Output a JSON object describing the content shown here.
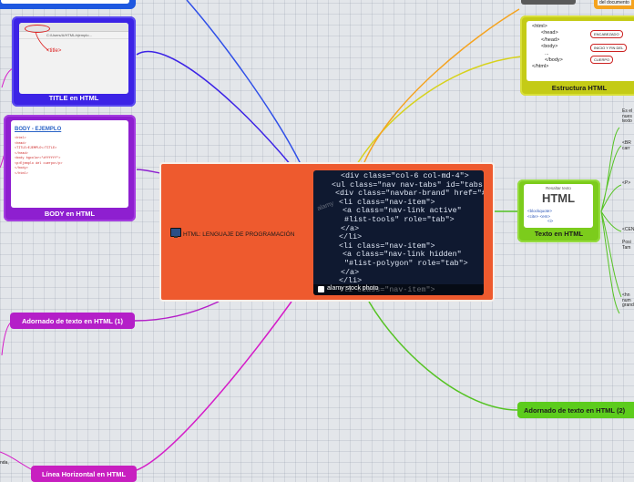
{
  "central": {
    "icon": "computer-icon",
    "title": "HTML: LENGUAJE DE PROGRAMACIÓN",
    "image_code": [
      "<div class=\"col-6 col-md-4\">",
      "<ul class=\"nav nav-tabs\" id=\"tabs\">",
      "<div class=\"navbar-brand\" href=\"#\">",
      "<li class=\"nav-item\">",
      "<a class=\"nav-link active\"",
      "#list-tools\" role=\"tab\">",
      "</a>",
      "</li>",
      "<li class=\"nav-item\">",
      "<a class=\"nav-link hidden\"",
      "\"#list-polygon\" role=\"tab\">",
      "</a>",
      "</li>",
      "<li class=\"nav-item\">"
    ],
    "image_credit": "alamy stock photo",
    "image_watermark": "alamy"
  },
  "nodes": {
    "title_html": {
      "label": "TITLE en HTML",
      "thumb_code": "<title>",
      "thumb_url": "C:/Users/A/HTML/ejemplo..."
    },
    "body_html": {
      "label": "BODY en HTML",
      "thumb_heading": "BODY - EJEMPLO",
      "thumb_lines": [
        "<html>",
        "<head>",
        "<TITLE>EJEMPLO</TITLE>",
        "</head>",
        "<body bgcolor=\"#ffffff\">",
        "<p>Ejemplo del cuerpo</p>",
        "</body>",
        "</html>"
      ]
    },
    "adornado1": {
      "label": "Adornado de texto en HTML (1)"
    },
    "linea_horizontal": {
      "label": "Línea Horizontal en HTML"
    },
    "estructura": {
      "label": "Estructura HTML",
      "code": [
        "<html>",
        "<head>",
        "</head>",
        "<body>",
        "...",
        "</body>",
        "</html>"
      ],
      "tags": [
        "ENCABEZADO",
        "INICIO Y FIN DEL",
        "CUERPO"
      ]
    },
    "texto": {
      "label": "Texto en HTML",
      "thumb_title": "Resaltar texto",
      "thumb_big": "HTML",
      "thumb_tags": [
        "<blockquote>",
        "<cite>",
        "<em>",
        "<i>"
      ]
    },
    "adornado2": {
      "label": "Adornado de texto en HTML (2)"
    }
  },
  "side_text": {
    "top_right": "del documento",
    "texto_items": [
      [
        "Es el",
        "nues",
        "texto"
      ],
      [
        "<BR",
        "carr"
      ],
      [
        "<P>"
      ],
      [
        "<CEN"
      ],
      [
        "Posi",
        "Tam"
      ],
      [
        "<hn",
        "num",
        "grand"
      ]
    ],
    "left_bottom": "nda,"
  },
  "colors": {
    "central": "#ee5a2e",
    "title_html": "#3c23e6",
    "body_html": "#8e1fd0",
    "adornado1": "#b41fc8",
    "linea_horizontal": "#c81fc0",
    "estructura": "#c4cb16",
    "texto": "#7ccc1c",
    "adornado2": "#5ccc1c",
    "top_left_node": "#1e58e0",
    "wire_blue": "#2f4fe8",
    "wire_purple": "#9c27d8",
    "wire_magenta": "#d51cc8",
    "wire_orange": "#f5a31f",
    "wire_yellow": "#d7d21c",
    "wire_green": "#55c323"
  }
}
